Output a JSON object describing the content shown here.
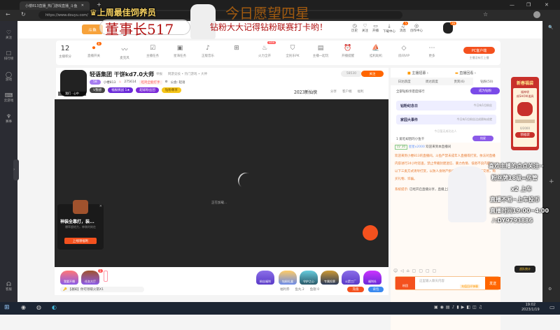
{
  "browser": {
    "tab_title": "小楼813直播_热门游戏直播_斗鱼",
    "url": "https://www.douyu.com/",
    "window_controls": [
      "—",
      "❐",
      "✕"
    ]
  },
  "left_sidebar": [
    {
      "icon": "heart-icon",
      "label": "关注"
    },
    {
      "icon": "list-icon",
      "label": "排行榜"
    },
    {
      "icon": "game-icon",
      "label": "游戏"
    },
    {
      "icon": "gamepad-icon",
      "label": "云游戏"
    },
    {
      "icon": "trophy-icon",
      "label": "赛事"
    },
    {
      "icon": "headset-icon",
      "label": "客服"
    }
  ],
  "header": {
    "nav": [
      {
        "icon": "history-icon",
        "label": "历史"
      },
      {
        "icon": "heart-icon",
        "label": "关注"
      },
      {
        "icon": "video-icon",
        "label": "开播"
      },
      {
        "icon": "download-icon",
        "label": "下载中心"
      },
      {
        "icon": "bell-icon",
        "label": "消息",
        "badge": "5"
      },
      {
        "icon": "bulb-icon",
        "label": "创作中心"
      }
    ],
    "avatar_badge": "26"
  },
  "toolbar": {
    "score": "12",
    "score_label": "主播积分",
    "items": [
      "直播开关",
      "麦克风",
      "主播任务",
      "星海任务",
      "正版音乐",
      "",
      "火力全开",
      "全民乐PK",
      "主播一起玩",
      "开播提醒",
      "挂机助机",
      "房间VIP",
      "更多"
    ],
    "pc_button": "PC客户端",
    "pc_sub": "主播没有打上播",
    "new_badge": "NEW",
    "switch_badge": "8"
  },
  "streamer": {
    "name": "轻语集团 干饼kd7.0大师",
    "report": "举报",
    "category": "网游竞技 • 热门游戏 • 大神",
    "level": "58",
    "id": "小楼813",
    "hot": "275614",
    "tag": "吃鸡全能打手",
    "notice": "公会: 轻语",
    "badges": [
      "V我想",
      "福报挑战 1★",
      "超级粉丝团",
      "钻粉尊享"
    ],
    "followers": "58530",
    "follow_button": "关注",
    "event_logo": "2023新仙侠",
    "actions": [
      "分享",
      "客户端",
      "福利"
    ],
    "avatar_caption": "我们 · 心中"
  },
  "video": {
    "loading": "正在加载...",
    "ad": {
      "title": "神装全靠打，装...",
      "desc": "爆率超给力，神装时刻在",
      "button": "上线领福利"
    }
  },
  "gift_bar": {
    "left": [
      "我要开播",
      "任务大厅"
    ],
    "left_badge": "1",
    "right": [
      "粉丝福利",
      "钻粉礼盒",
      "守护之心",
      "专属投票",
      "火箭工厂",
      "福利社"
    ],
    "notice": "【通知】你可领取火箭X1",
    "welfare": "福利券",
    "fish_balls": "鱼丸 2",
    "fish_wings": "鱼翅 0",
    "charge": "充值",
    "bag": "背包"
  },
  "chat": {
    "top": [
      "主播招募",
      "直播回看"
    ],
    "tabs": [
      "日达跃度",
      "周达跃度",
      "贵宾(6)",
      "钻粉(50)"
    ],
    "rank_title": "全部钻粉亲密度排行",
    "join": "成为钻粉",
    "cards": [
      {
        "title": "钻粉纪念日",
        "desc": "今日有1位粉丝"
      },
      {
        "title": "家园大事件",
        "desc": "今日有1位粉丝达成隔有成就"
      }
    ],
    "empty": "今日暂无成功达人",
    "rank_item": "1  爱吃却因的小鱼干",
    "rank_btn": "抢星",
    "messages": [
      {
        "level": "LV 30",
        "user": "星星x2000",
        "text": "欢迎来到本直播间"
      },
      {
        "text": "欢迎来到小楼813的直播间。斗鱼严禁未成年人直播或打赏。依法对直播内容进行24小时巡查，禁止传播封建迷信、暴力色情、低俗不良内容；以下三类方式诱导打赏，以防人身财产损失，请勿轻信任何私下交易，购买礼物、诈骗。"
      },
      {
        "label": "系统提示:",
        "text": "已经开启直播分享，直播上面显示，默认为灰色，可在"
      }
    ],
    "input_placeholder": "这里输入聊天内容",
    "input_hint": "充值回评弹幕",
    "send": "发送",
    "medal": "粉团"
  },
  "right_promo": {
    "title": "新春福袋",
    "sub1": "福神袋",
    "sub2": "成SHOW道具",
    "progress": "0/2000",
    "progress_value": 0,
    "button": "领福袋",
    "bottom": "战队统计"
  },
  "overlay": {
    "top_text": "上周最佳饲养员",
    "top_name": "董事长517",
    "wish": "今日愿望四星",
    "reminder": "钻粉大大记得钻粉联赛打卡哟！",
    "lines": [
      "喜欢主播的点点关注~",
      "粉丝牌18级=房管",
      "x2 上车",
      "直播不易~上车投币",
      "直播时间19:00~4:00"
    ],
    "tiktok": ":DY9793886"
  },
  "taskbar": {
    "time": "19:02",
    "date": "2023/1/19"
  }
}
